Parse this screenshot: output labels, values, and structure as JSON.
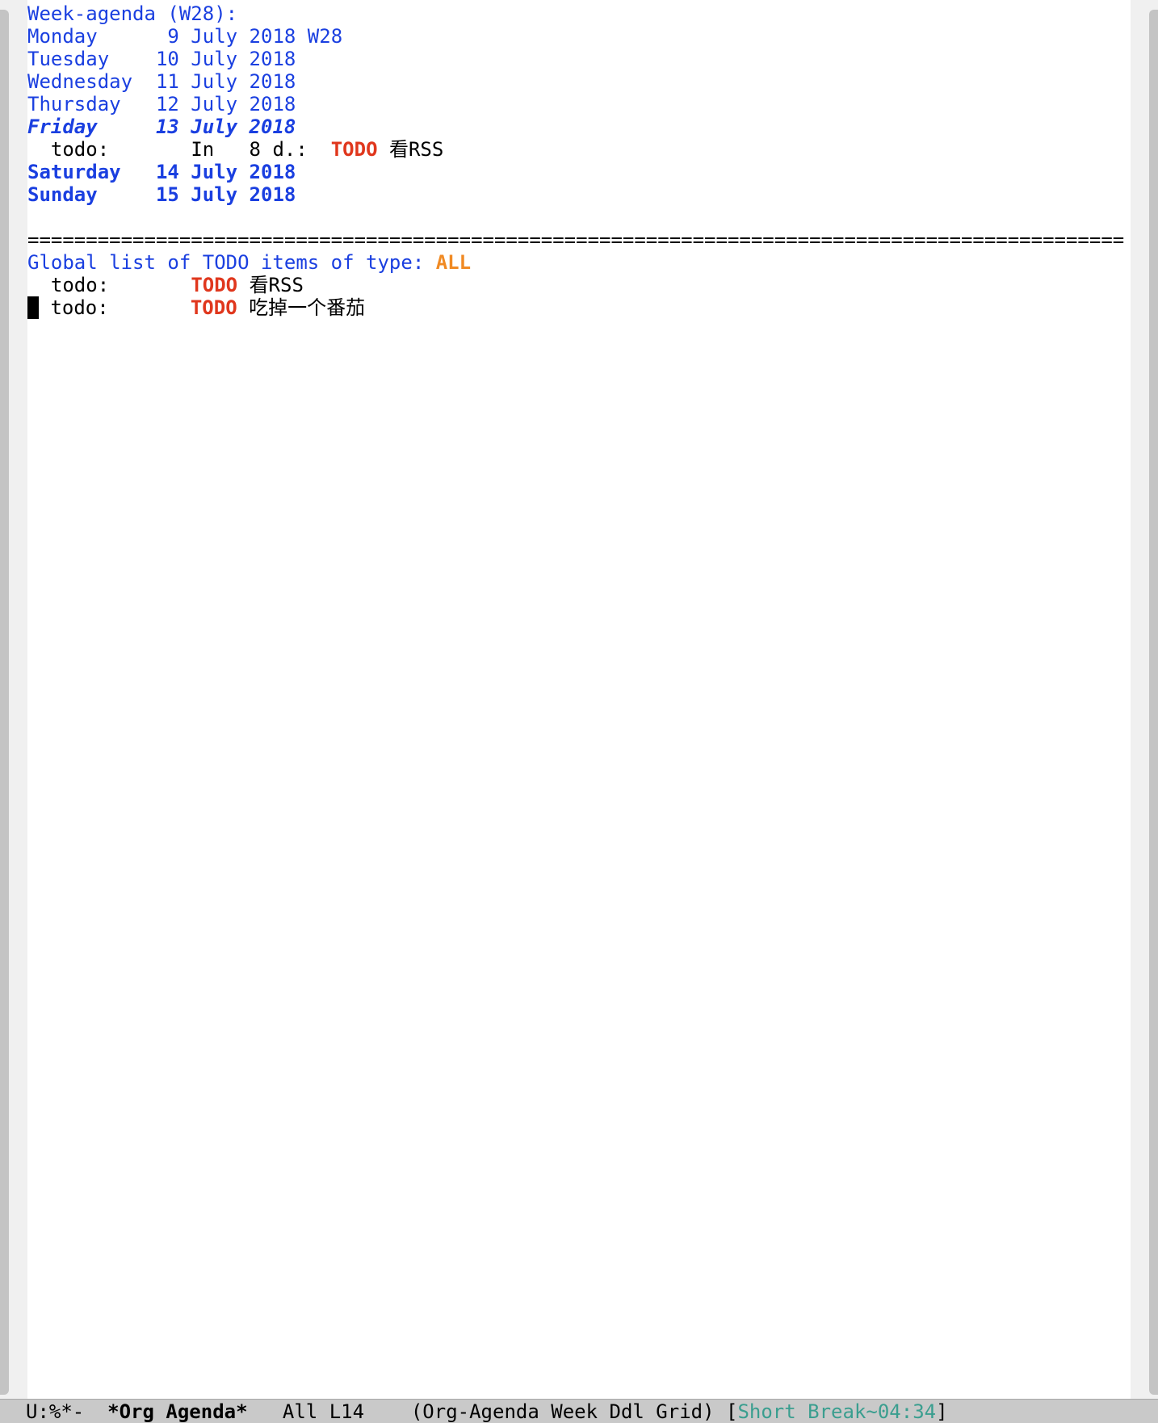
{
  "agenda": {
    "header": "Week-agenda (W28):",
    "days": [
      {
        "name": "Monday",
        "date": "  9 July 2018",
        "week": " W28"
      },
      {
        "name": "Tuesday",
        "date": " 10 July 2018"
      },
      {
        "name": "Wednesday",
        "date": " 11 July 2018"
      },
      {
        "name": "Thursday",
        "date": " 12 July 2018"
      },
      {
        "name": "Friday",
        "date": " 13 July 2018"
      },
      {
        "name": "Saturday",
        "date": " 14 July 2018"
      },
      {
        "name": "Sunday",
        "date": " 15 July 2018"
      }
    ],
    "friday_entry": {
      "category": "  todo:",
      "deadline": "In   8 d.:",
      "keyword": "TODO",
      "title": "看RSS"
    }
  },
  "separator": "==========================================================================================================================",
  "global_todo": {
    "header_prefix": "Global list of TODO items of type: ",
    "type": "ALL",
    "items": [
      {
        "category": " todo:",
        "keyword": "TODO",
        "title": "看RSS"
      },
      {
        "category": " todo:",
        "keyword": "TODO",
        "title": "吃掉一个番茄"
      }
    ]
  },
  "modeline": {
    "status": "U:%*-",
    "buffer": "*Org Agenda*",
    "position": "All L14",
    "modes": "(Org-Agenda Week Ddl Grid)",
    "pomodoro": "Short Break~04:34",
    "bracket_open": "[",
    "bracket_close": "]"
  },
  "colors": {
    "agenda_blue": "#1a3fe0",
    "todo_red": "#e0371d",
    "type_orange": "#f08a24",
    "pomodoro_teal": "#3a9e8f",
    "modeline_bg": "#c9c9c9"
  }
}
